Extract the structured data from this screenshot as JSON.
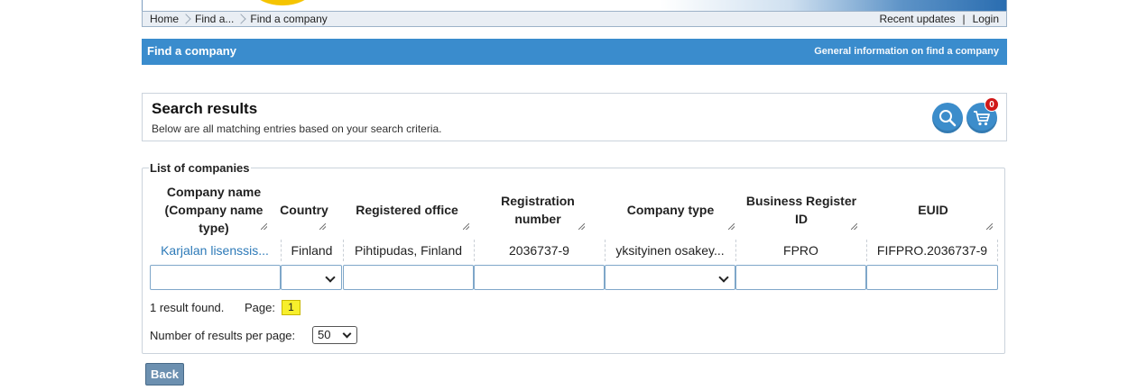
{
  "breadcrumb": {
    "items": [
      "Home",
      "Find a...",
      "Find a company"
    ]
  },
  "toplinks": {
    "recent_updates": "Recent updates",
    "separator": "|",
    "login": "Login"
  },
  "titlebar": {
    "title": "Find a company",
    "info_link": "General information on find a company"
  },
  "results_panel": {
    "heading": "Search results",
    "subtext": "Below are all matching entries based on your search criteria.",
    "search_icon": "search-icon",
    "cart_icon": "cart-icon",
    "cart_count": "0"
  },
  "companies": {
    "legend": "List of companies",
    "columns": [
      "Company name (Company name type)",
      "Country",
      "Registered office",
      "Registration number",
      "Company type",
      "Business Register ID",
      "EUID"
    ],
    "rows": [
      {
        "name": "Karjalan lisenssis...",
        "country": "Finland",
        "office": "Pihtipudas, Finland",
        "regnum": "2036737-9",
        "type": "yksityinen osakey...",
        "brid": "FPRO",
        "euid": "FIFPRO.2036737-9"
      }
    ]
  },
  "pagination": {
    "count_text": "1 result found.",
    "page_label": "Page:",
    "current_page": "1",
    "per_page_label": "Number of results per page:",
    "per_page_value": "50"
  },
  "back_label": "Back",
  "colors": {
    "title_bar": "#3a8ccd",
    "link": "#2d7ab8",
    "badge": "#d01818",
    "page_highlight": "#f7ef2c",
    "back_button": "#6c90b0"
  }
}
